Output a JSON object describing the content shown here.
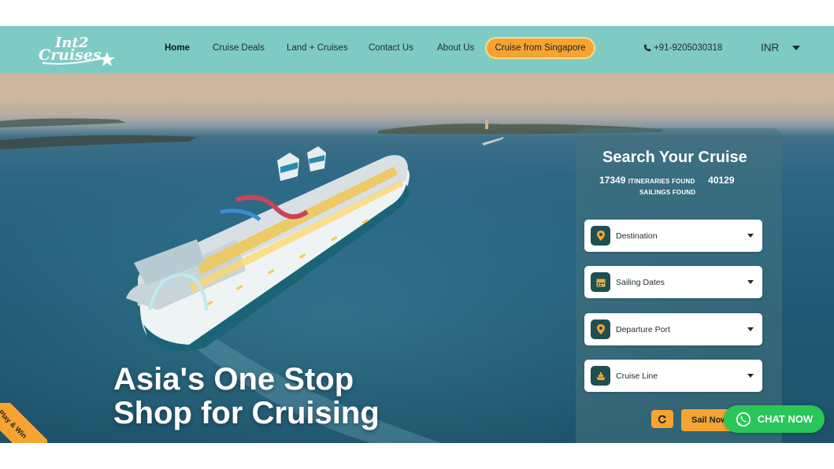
{
  "brand": {
    "logo_text_line1": "Int2",
    "logo_text_line2": "Cruises"
  },
  "nav": {
    "items": [
      {
        "label": "Home"
      },
      {
        "label": "Cruise Deals"
      },
      {
        "label": "Land + Cruises"
      },
      {
        "label": "Contact Us"
      },
      {
        "label": "About Us"
      }
    ],
    "cta_label": "Cruise from Singapore",
    "phone": "+91-9205030318",
    "currency": "INR"
  },
  "hero": {
    "headline_line1": "Asia's One Stop",
    "headline_line2": "Shop for Cruising",
    "ribbon_label": "Play & Win"
  },
  "search": {
    "title": "Search Your Cruise",
    "itineraries_count": "17349",
    "itineraries_label": "ITINERARIES FOUND",
    "sailings_count": "40129",
    "sailings_label": "SAILINGS FOUND",
    "fields": [
      {
        "label": "Destination",
        "icon": "map-pin-icon"
      },
      {
        "label": "Sailing Dates",
        "icon": "calendar-icon"
      },
      {
        "label": "Departure Port",
        "icon": "map-pin-icon"
      },
      {
        "label": "Cruise Line",
        "icon": "ship-icon"
      }
    ],
    "submit_label": "Sail Now"
  },
  "chat": {
    "label": "CHAT NOW"
  },
  "colors": {
    "nav_bg": "#7fcbc4",
    "accent": "#f6a431",
    "chat": "#29c659",
    "field_icon_bg": "#1e4f53"
  }
}
